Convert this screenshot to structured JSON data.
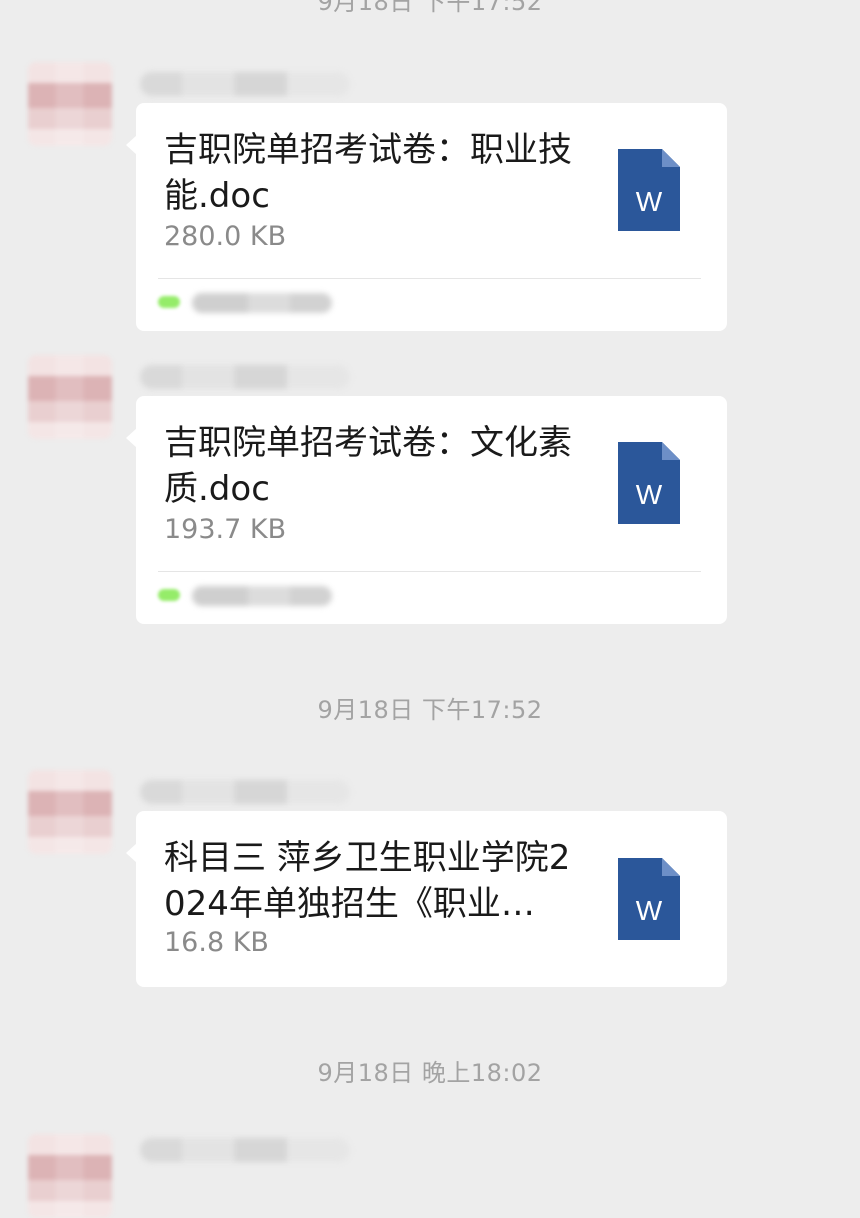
{
  "timestamps": {
    "top": "9月18日 下午17:52",
    "middle": "9月18日 下午17:52",
    "bottom": "9月18日 晚上18:02"
  },
  "messages": [
    {
      "file_name": "吉职院单招考试卷：职业技能.doc",
      "file_size": "280.0 KB",
      "icon": "word-document-icon"
    },
    {
      "file_name": "吉职院单招考试卷：文化素质.doc",
      "file_size": "193.7 KB",
      "icon": "word-document-icon"
    },
    {
      "file_name": "科目三 萍乡卫生职业学院2024年单独招生《职业…",
      "file_size": "16.8 KB",
      "icon": "word-document-icon"
    }
  ],
  "colors": {
    "background": "#ededed",
    "bubble": "#ffffff",
    "word_blue": "#2b579a",
    "source_green": "#95ec69",
    "timestamp_gray": "#a3a3a3"
  }
}
